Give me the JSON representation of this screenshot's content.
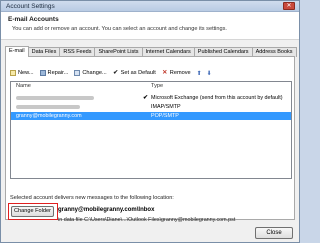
{
  "window": {
    "title": "Account Settings",
    "close_glyph": "✕"
  },
  "header": {
    "title": "E-mail Accounts",
    "subtitle": "You can add or remove an account. You can select an account and change its settings."
  },
  "tabs": [
    {
      "label": "E-mail",
      "active": true
    },
    {
      "label": "Data Files",
      "active": false
    },
    {
      "label": "RSS Feeds",
      "active": false
    },
    {
      "label": "SharePoint Lists",
      "active": false
    },
    {
      "label": "Internet Calendars",
      "active": false
    },
    {
      "label": "Published Calendars",
      "active": false
    },
    {
      "label": "Address Books",
      "active": false
    }
  ],
  "toolbar": {
    "new_label": "New...",
    "repair_label": "Repair...",
    "change_label": "Change...",
    "set_default_label": "Set as Default",
    "remove_label": "Remove",
    "up_glyph": "⬆",
    "down_glyph": "⬇"
  },
  "accounts_table": {
    "columns": [
      "Name",
      "Type"
    ],
    "rows": [
      {
        "name": "",
        "type": "Microsoft Exchange (send from this account by default)",
        "default": true,
        "selected": false
      },
      {
        "name": "",
        "type": "IMAP/SMTP",
        "default": false,
        "selected": false
      },
      {
        "name": "granny@mobilegranny.com",
        "type": "POP/SMTP",
        "default": false,
        "selected": true
      }
    ]
  },
  "delivery": {
    "label": "Selected account delivers new messages to the following location:",
    "change_folder_label": "Change Folder",
    "location": "granny@mobilegranny.com\\Inbox",
    "data_file": "in data file C:\\Users\\Diane\\...\\Outlook Files\\granny@mobilegranny.com.pst"
  },
  "footer": {
    "close_label": "Close"
  },
  "colors": {
    "selection": "#3399ff",
    "highlight_box": "#e02020"
  }
}
